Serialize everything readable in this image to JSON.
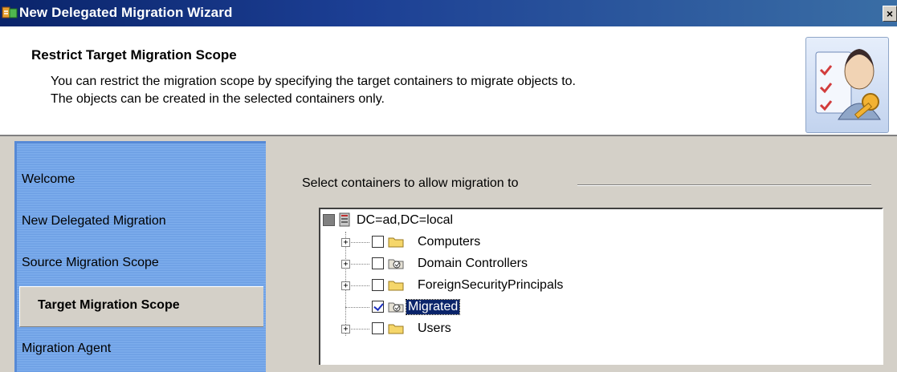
{
  "window": {
    "title": "New Delegated Migration Wizard",
    "close_label": "×"
  },
  "header": {
    "heading": "Restrict Target Migration Scope",
    "desc_line1": "You can restrict the migration scope by specifying the target containers to migrate objects to.",
    "desc_line2": "The objects can be created in the selected containers only."
  },
  "sidebar": {
    "items": [
      {
        "label": "Welcome"
      },
      {
        "label": "New Delegated Migration"
      },
      {
        "label": "Source Migration Scope"
      },
      {
        "label": "Target Migration Scope",
        "active": true
      },
      {
        "label": "Migration Agent"
      }
    ]
  },
  "content": {
    "group_label": "Select containers to allow migration to"
  },
  "tree": {
    "root": {
      "label": "DC=ad,DC=local",
      "check_state": "partial"
    },
    "children": [
      {
        "label": "Computers",
        "checked": false,
        "icon": "folder-icon",
        "expandable": true
      },
      {
        "label": "Domain Controllers",
        "checked": false,
        "icon": "ou-folder-icon",
        "expandable": true
      },
      {
        "label": "ForeignSecurityPrincipals",
        "checked": false,
        "icon": "folder-icon",
        "expandable": true
      },
      {
        "label": "Migrated",
        "checked": true,
        "icon": "ou-folder-icon",
        "expandable": false,
        "selected": true
      },
      {
        "label": "Users",
        "checked": false,
        "icon": "folder-icon",
        "expandable": true
      }
    ]
  },
  "colors": {
    "titlebar": "#0a246a",
    "sidebar": "#7aaaea",
    "selection": "#0a246a",
    "check": "#1b2fbf"
  }
}
